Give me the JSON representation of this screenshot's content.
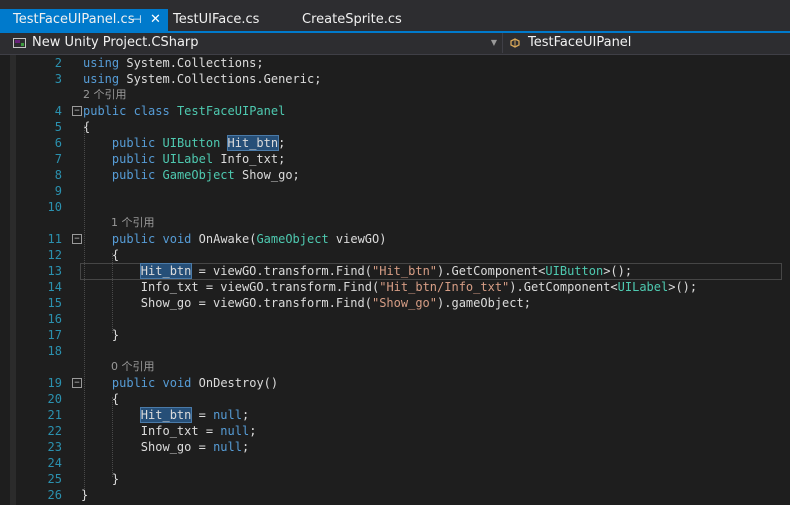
{
  "tabs": [
    {
      "label": "TestFaceUIPanel.cs",
      "active": true
    },
    {
      "label": "TestUIFace.cs",
      "active": false
    },
    {
      "label": "CreateSprite.cs",
      "active": false
    }
  ],
  "tab_pin": "⊣",
  "tab_close": "✕",
  "navbar": {
    "project": "New Unity Project.CSharp",
    "class": "TestFaceUIPanel",
    "dropdown_arrow": "▼"
  },
  "code": {
    "l2_ln": "2",
    "l2": "System.Collections;",
    "using": "using",
    "l3_ln": "3",
    "l3": "System.Collections.Generic;",
    "ref_class": "2 个引用",
    "l4_ln": "4",
    "public": "public",
    "class": "class",
    "classname": "TestFaceUIPanel",
    "l5_ln": "5",
    "lbrace": "{",
    "l6_ln": "6",
    "uibutton": "UIButton",
    "hit_btn": "Hit_btn",
    "semi": ";",
    "l7_ln": "7",
    "uilabel": "UILabel",
    "info_txt_decl": "Info_txt;",
    "l8_ln": "8",
    "gameobject": "GameObject",
    "show_go_decl": "Show_go;",
    "l9_ln": "9",
    "l10_ln": "10",
    "ref_awake": "1 个引用",
    "l11_ln": "11",
    "void": "void",
    "onawake": "OnAwake(",
    "viewgo_param": " viewGO)",
    "l12_ln": "12",
    "l13_ln": "13",
    "l13_a": " = viewGO.transform.Find(",
    "l13_s": "\"Hit_btn\"",
    "l13_b": ").GetComponent<",
    "l13_c": ">();",
    "l14_ln": "14",
    "l14_a": "Info_txt = viewGO.transform.Find(",
    "l14_s": "\"Hit_btn/Info_txt\"",
    "l14_b": ").GetComponent<",
    "l14_c": ">();",
    "l15_ln": "15",
    "l15_a": "Show_go = viewGO.transform.Find(",
    "l15_s": "\"Show_go\"",
    "l15_b": ").gameObject;",
    "l16_ln": "16",
    "l17_ln": "17",
    "rbrace": "}",
    "l18_ln": "18",
    "ref_destroy": "0 个引用",
    "l19_ln": "19",
    "ondestroy": "OnDestroy()",
    "l20_ln": "20",
    "l21_ln": "21",
    "eq": " = ",
    "null": "null",
    "l22_ln": "22",
    "info_txt": "Info_txt",
    "l23_ln": "23",
    "show_go": "Show_go",
    "l24_ln": "24",
    "l25_ln": "25",
    "l26_ln": "26",
    "fold_minus": "−"
  },
  "colors": {
    "accent": "#007acc",
    "keyword": "#569cd6",
    "type": "#4ec9b0",
    "string": "#d69d85",
    "linenum": "#2b91af"
  }
}
